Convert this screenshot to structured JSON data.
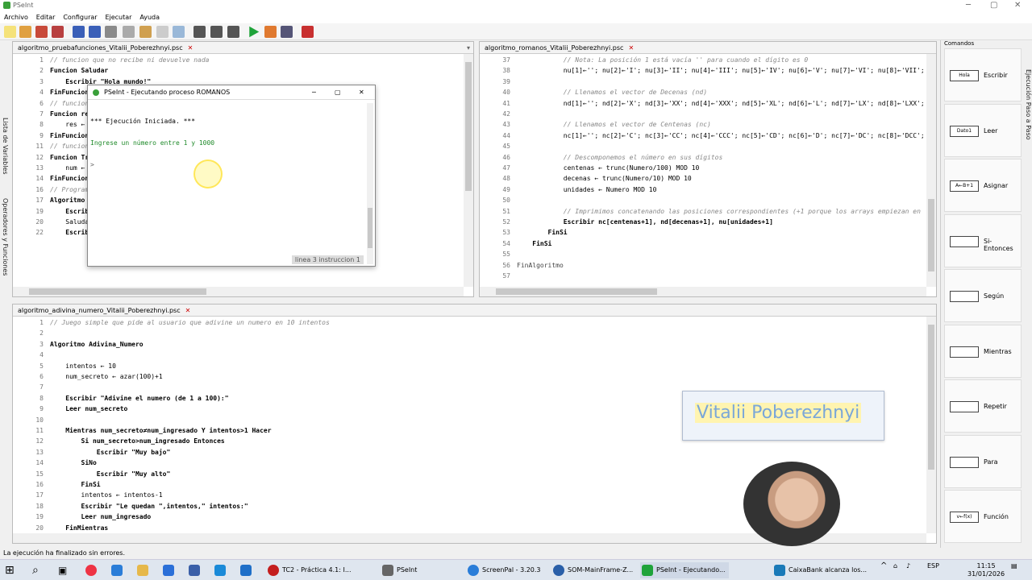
{
  "app": {
    "title": "PSeInt"
  },
  "menu": [
    "Archivo",
    "Editar",
    "Configurar",
    "Ejecutar",
    "Ayuda"
  ],
  "side_tabs": {
    "variables": "Lista de Variables",
    "operators": "Operadores y Funciones"
  },
  "editor1": {
    "tab": "algoritmo_pruebafunciones_Vitalii_Poberezhnyi.psc",
    "lines": [
      {
        "n": "1",
        "t": "// funcion que no recibe ni devuelve nada",
        "k": "cm"
      },
      {
        "n": "2",
        "t": "Funcion Saludar",
        "k": "kw"
      },
      {
        "n": "3",
        "t": "    Escribir \"Hola mundo!\"",
        "k": "kw"
      },
      {
        "n": "4",
        "t": "FinFuncion",
        "k": "kw"
      },
      {
        "n": "6",
        "t": "// funcion q",
        "k": "cm"
      },
      {
        "n": "7",
        "t": "Funcion res",
        "k": "kw"
      },
      {
        "n": "8",
        "t": "    res ← nu",
        "k": ""
      },
      {
        "n": "9",
        "t": "FinFuncion",
        "k": "kw"
      },
      {
        "n": "11",
        "t": "// funcion q",
        "k": "cm"
      },
      {
        "n": "12",
        "t": "Funcion Trip",
        "k": "kw"
      },
      {
        "n": "13",
        "t": "    num ← nu",
        "k": ""
      },
      {
        "n": "14",
        "t": "FinFuncion",
        "k": "kw"
      },
      {
        "n": "16",
        "t": "// Programa p",
        "k": "cm"
      },
      {
        "n": "17",
        "t": "Algoritmo P",
        "k": "kw"
      },
      {
        "n": "19",
        "t": "    Escribi",
        "k": "kw"
      },
      {
        "n": "20",
        "t": "    Saludar",
        "k": ""
      },
      {
        "n": "22",
        "t": "    Escribir \"Ingrese un valor numérico para x:\"",
        "k": "kw"
      }
    ]
  },
  "editor2": {
    "tab": "algoritmo_romanos_Vitalii_Poberezhnyi.psc",
    "lines": [
      {
        "n": "37",
        "t": "            // Nota: La posición 1 está vacía '' para cuando el dígito es 0",
        "k": "cm"
      },
      {
        "n": "38",
        "t": "            nu[1]←''; nu[2]←'I'; nu[3]←'II'; nu[4]←'III'; nu[5]←'IV'; nu[6]←'V'; nu[7]←'VI'; nu[8]←'VII'; nu[9]",
        "k": ""
      },
      {
        "n": "39",
        "t": "",
        "k": ""
      },
      {
        "n": "40",
        "t": "            // Llenamos el vector de Decenas (nd)",
        "k": "cm"
      },
      {
        "n": "41",
        "t": "            nd[1]←''; nd[2]←'X'; nd[3]←'XX'; nd[4]←'XXX'; nd[5]←'XL'; nd[6]←'L'; nd[7]←'LX'; nd[8]←'LXX'; nd[9]",
        "k": ""
      },
      {
        "n": "42",
        "t": "",
        "k": ""
      },
      {
        "n": "43",
        "t": "            // Llenamos el vector de Centenas (nc)",
        "k": "cm"
      },
      {
        "n": "44",
        "t": "            nc[1]←''; nc[2]←'C'; nc[3]←'CC'; nc[4]←'CCC'; nc[5]←'CD'; nc[6]←'D'; nc[7]←'DC'; nc[8]←'DCC'; nc[9]",
        "k": ""
      },
      {
        "n": "45",
        "t": "",
        "k": ""
      },
      {
        "n": "46",
        "t": "            // Descomponemos el número en sus dígitos",
        "k": "cm"
      },
      {
        "n": "47",
        "t": "            centenas ← trunc(Numero/100) MOD 10",
        "k": ""
      },
      {
        "n": "48",
        "t": "            decenas ← trunc(Numero/10) MOD 10",
        "k": ""
      },
      {
        "n": "49",
        "t": "            unidades ← Numero MOD 10",
        "k": ""
      },
      {
        "n": "50",
        "t": "",
        "k": ""
      },
      {
        "n": "51",
        "t": "            // Imprimimos concatenando las posiciones correspondientes (+1 porque los arrays empiezan en 1)",
        "k": "cm"
      },
      {
        "n": "52",
        "t": "            Escribir nc[centenas+1], nd[decenas+1], nu[unidades+1]",
        "k": "kw"
      },
      {
        "n": "53",
        "t": "        FinSi",
        "k": "kw"
      },
      {
        "n": "54",
        "t": "    FinSi",
        "k": "kw"
      },
      {
        "n": "55",
        "t": "",
        "k": ""
      },
      {
        "n": "56",
        "t": "FinAlgoritmo",
        "k": "st"
      },
      {
        "n": "57",
        "t": "",
        "k": ""
      }
    ]
  },
  "editor3": {
    "tab": "algoritmo_adivina_numero_Vitalii_Poberezhnyi.psc",
    "lines": [
      {
        "n": "1",
        "t": "// Juego simple que pide al usuario que adivine un numero en 10 intentos",
        "k": "cm"
      },
      {
        "n": "2",
        "t": "",
        "k": ""
      },
      {
        "n": "3",
        "t": "Algoritmo Adivina_Numero",
        "k": "kw"
      },
      {
        "n": "4",
        "t": "",
        "k": ""
      },
      {
        "n": "5",
        "t": "    intentos ← 10",
        "k": ""
      },
      {
        "n": "6",
        "t": "    num_secreto ← azar(100)+1",
        "k": ""
      },
      {
        "n": "7",
        "t": "",
        "k": ""
      },
      {
        "n": "8",
        "t": "    Escribir \"Adivine el numero (de 1 a 100):\"",
        "k": "kw"
      },
      {
        "n": "9",
        "t": "    Leer num_secreto",
        "k": "kw"
      },
      {
        "n": "10",
        "t": "",
        "k": ""
      },
      {
        "n": "11",
        "t": "    Mientras num_secreto≠num_ingresado Y intentos>1 Hacer",
        "k": "kw"
      },
      {
        "n": "12",
        "t": "        Si num_secreto>num_ingresado Entonces",
        "k": "kw"
      },
      {
        "n": "13",
        "t": "            Escribir \"Muy bajo\"",
        "k": "kw"
      },
      {
        "n": "14",
        "t": "        SiNo",
        "k": "kw"
      },
      {
        "n": "15",
        "t": "            Escribir \"Muy alto\"",
        "k": "kw"
      },
      {
        "n": "16",
        "t": "        FinSi",
        "k": "kw"
      },
      {
        "n": "17",
        "t": "        intentos ← intentos-1",
        "k": ""
      },
      {
        "n": "18",
        "t": "        Escribir \"Le quedan \",intentos,\" intentos:\"",
        "k": "kw"
      },
      {
        "n": "19",
        "t": "        Leer num_ingresado",
        "k": "kw"
      },
      {
        "n": "20",
        "t": "    FinMientras",
        "k": "kw"
      }
    ]
  },
  "run_dialog": {
    "title": "PSeInt - Ejecutando proceso ROMANOS",
    "output": [
      "*** Ejecución Iniciada. ***",
      "Ingrese un número entre 1 y 1000",
      ">"
    ],
    "status": "linea 3 instruccion 1"
  },
  "commands": {
    "header": "Comandos",
    "items": [
      {
        "label": "Escribir",
        "icon": "Hola"
      },
      {
        "label": "Leer",
        "icon": "Dato1"
      },
      {
        "label": "Asignar",
        "icon": "A←B+1"
      },
      {
        "label": "Si-Entonces",
        "icon": ""
      },
      {
        "label": "Según",
        "icon": ""
      },
      {
        "label": "Mientras",
        "icon": ""
      },
      {
        "label": "Repetir",
        "icon": ""
      },
      {
        "label": "Para",
        "icon": ""
      },
      {
        "label": "Función",
        "icon": "v←f(x)"
      }
    ],
    "side_label": "Ejecución Paso a Paso"
  },
  "status_text": "La ejecución ha finalizado sin errores.",
  "watermark": "Vitalii Poberezhnyi",
  "taskbar": {
    "apps": [
      "TC2 - Práctica 4.1: I...",
      "PSeInt",
      "ScreenPal - 3.20.3",
      "SOM-MainFrame-Z...",
      "PSeInt - Ejecutando...",
      "CaixaBank alcanza los..."
    ],
    "lang": "ESP",
    "time": "11:15",
    "date": "31/01/2026"
  },
  "colors": {
    "accent": "#3aa03a",
    "keyword": "#000000",
    "comment": "#888888"
  }
}
